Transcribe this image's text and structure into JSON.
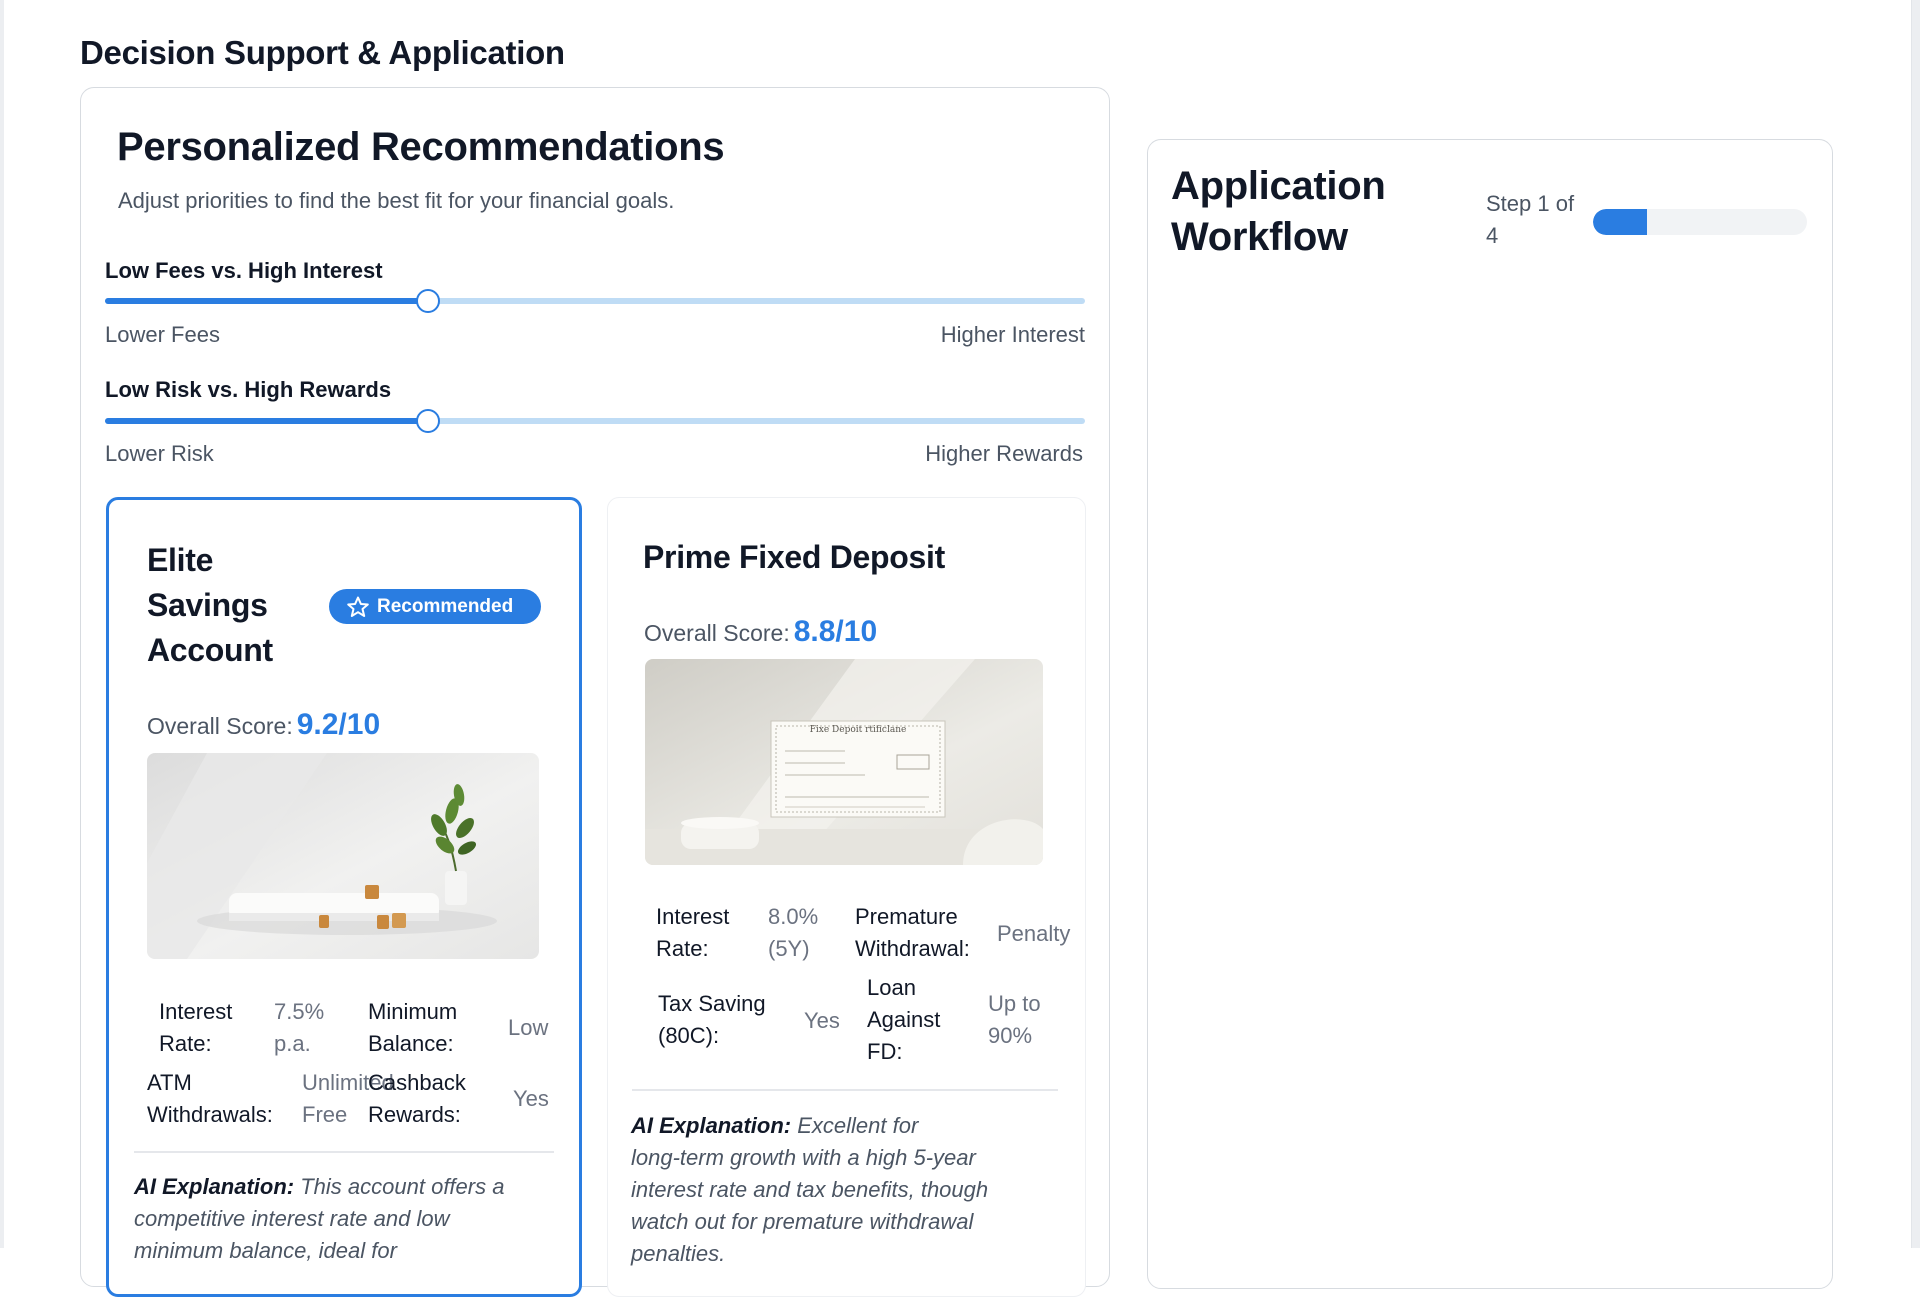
{
  "section": {
    "title": "Decision Support & Application"
  },
  "recommendations": {
    "title": "Personalized Recommendations",
    "subtitle": "Adjust priorities to find the best fit for your financial goals.",
    "sliders": [
      {
        "label": "Low Fees vs. High Interest",
        "min_label": "Lower Fees",
        "max_label": "Higher Interest",
        "value_percent": 33
      },
      {
        "label": "Low Risk vs. High Rewards",
        "min_label": "Lower Risk",
        "max_label": "Higher Rewards",
        "value_percent": 33
      }
    ],
    "products": [
      {
        "name_lines": [
          "Elite",
          "Savings",
          "Account"
        ],
        "badge": "Recommended",
        "score_label": "Overall Score:",
        "score": "9.2/10",
        "attributes": [
          {
            "label_lines": [
              "Interest",
              "Rate:"
            ],
            "value_lines": [
              "7.5%",
              "p.a."
            ]
          },
          {
            "label_lines": [
              "Minimum",
              "Balance:"
            ],
            "value_lines": [
              "Low"
            ]
          },
          {
            "label_lines": [
              "ATM",
              "Withdrawals:"
            ],
            "value_lines": [
              "Unlimited",
              "Free"
            ]
          },
          {
            "label_lines": [
              "Cashback",
              "Rewards:"
            ],
            "value_lines": [
              "Yes"
            ]
          }
        ],
        "ai_label": "AI Explanation:",
        "ai_text_lines": [
          " This account offers a",
          "competitive interest rate and low",
          "minimum balance, ideal for"
        ]
      },
      {
        "name": "Prime Fixed Deposit",
        "score_label": "Overall Score:",
        "score": "8.8/10",
        "certificate_title": "Fixe Depoit rtificlane",
        "attributes": [
          {
            "label_lines": [
              "Interest",
              "Rate:"
            ],
            "value_lines": [
              "8.0%",
              "(5Y)"
            ]
          },
          {
            "label_lines": [
              "Premature",
              "Withdrawal:"
            ],
            "value_lines": [
              "Penalty"
            ]
          },
          {
            "label_lines": [
              "Tax Saving",
              "(80C):"
            ],
            "value_lines": [
              "Yes"
            ]
          },
          {
            "label_lines": [
              "Loan",
              "Against",
              "FD:"
            ],
            "value_lines": [
              "Up to",
              "90%"
            ]
          }
        ],
        "ai_label": "AI Explanation:",
        "ai_text_lines": [
          " Excellent for",
          "long-term growth with a high 5-year",
          "interest rate and tax benefits, though",
          "watch out for premature withdrawal",
          "penalties."
        ]
      }
    ]
  },
  "workflow": {
    "title_lines": [
      "Application",
      "Workflow"
    ],
    "step_lines": [
      "Step 1 of",
      "4"
    ],
    "progress_fraction": 0.25
  },
  "colors": {
    "accent": "#2a7de1",
    "track": "#bfdcf5",
    "border": "#d7dbe0"
  },
  "icons": {
    "badge": "star-outline-icon"
  }
}
